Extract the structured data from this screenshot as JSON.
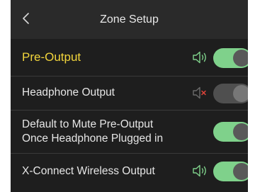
{
  "header": {
    "back_icon": "chevron-left-icon",
    "title": "Zone Setup"
  },
  "rows": [
    {
      "label": "Pre-Output",
      "label_color": "#f2d53c",
      "speaker_icon": "speaker-on-icon",
      "toggle_on": true
    },
    {
      "label": "Headphone Output",
      "speaker_icon": "speaker-muted-icon",
      "toggle_on": false
    },
    {
      "label_line1": "Default to Mute Pre-Output",
      "label_line2": "Once Headphone Plugged in",
      "toggle_on": true
    },
    {
      "label": "X-Connect Wireless Output",
      "speaker_icon": "speaker-on-icon",
      "toggle_on": true
    }
  ],
  "colors": {
    "background": "#1e1e1e",
    "header_bg": "#2a2a2a",
    "accent_on": "#7fd18b",
    "highlight_text": "#f2d53c",
    "mute_x": "#e0443a"
  }
}
